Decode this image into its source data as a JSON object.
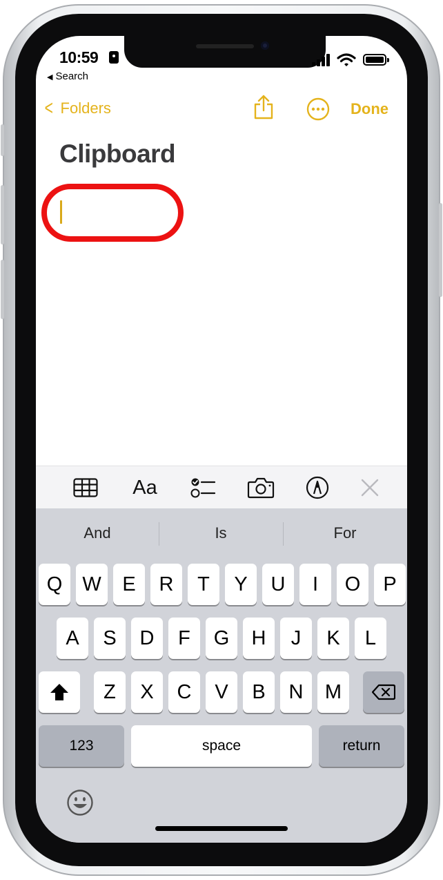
{
  "status_bar": {
    "time": "10:59",
    "back_app": "Search"
  },
  "nav": {
    "back_label": "Folders",
    "done_label": "Done"
  },
  "note": {
    "title": "Clipboard"
  },
  "toolbar": {
    "items": [
      "table-icon",
      "format-icon",
      "checklist-icon",
      "camera-icon",
      "markup-icon",
      "close-icon"
    ],
    "format_label": "Aa"
  },
  "keyboard": {
    "predictions": [
      "And",
      "Is",
      "For"
    ],
    "row1": [
      "Q",
      "W",
      "E",
      "R",
      "T",
      "Y",
      "U",
      "I",
      "O",
      "P"
    ],
    "row2": [
      "A",
      "S",
      "D",
      "F",
      "G",
      "H",
      "J",
      "K",
      "L"
    ],
    "row3": [
      "Z",
      "X",
      "C",
      "V",
      "B",
      "N",
      "M"
    ],
    "numbers_label": "123",
    "space_label": "space",
    "return_label": "return"
  },
  "colors": {
    "accent": "#e4b31c",
    "highlight": "#ec1212",
    "keyboard_bg": "#d1d3d9"
  }
}
